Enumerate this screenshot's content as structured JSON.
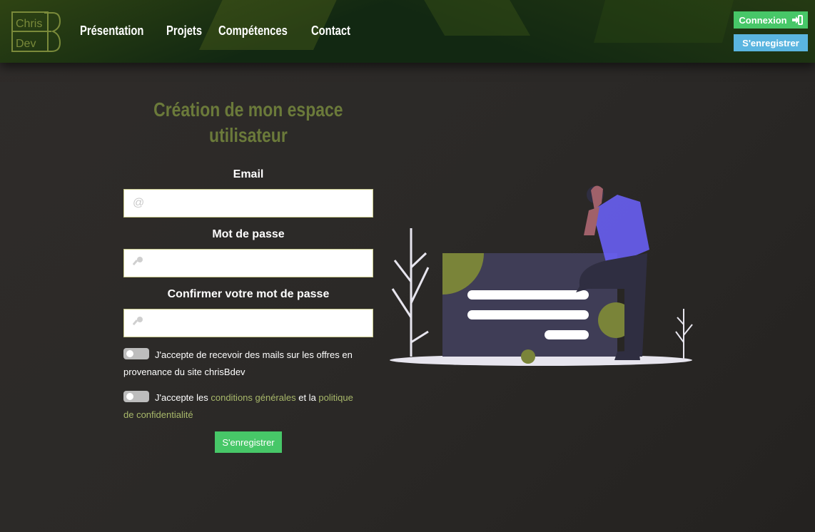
{
  "header": {
    "logo": {
      "line1": "Chris",
      "line2": "Dev",
      "letter": "B"
    },
    "nav": [
      "Présentation",
      "Projets",
      "Compétences",
      "Contact"
    ],
    "login_label": "Connexion",
    "register_label": "S'enregistrer"
  },
  "form": {
    "title_line1": "Création de mon espace",
    "title_line2": "utilisateur",
    "email_label": "Email",
    "email_icon": "@",
    "password_label": "Mot de passe",
    "confirm_label": "Confirmer votre mot de passe",
    "consent_mail": "J'accepte de recevoir des mails sur les offres en provenance du site chrisBdev",
    "consent_terms_pre": "J'accepte les ",
    "consent_terms_link1": "conditions générales",
    "consent_terms_mid": " et la ",
    "consent_terms_link2": "politique de confidentialité",
    "submit_label": "S'enregistrer"
  },
  "colors": {
    "accent_green": "#47c768",
    "accent_blue": "#5ab5e0",
    "title_olive": "#6b7a3a"
  }
}
